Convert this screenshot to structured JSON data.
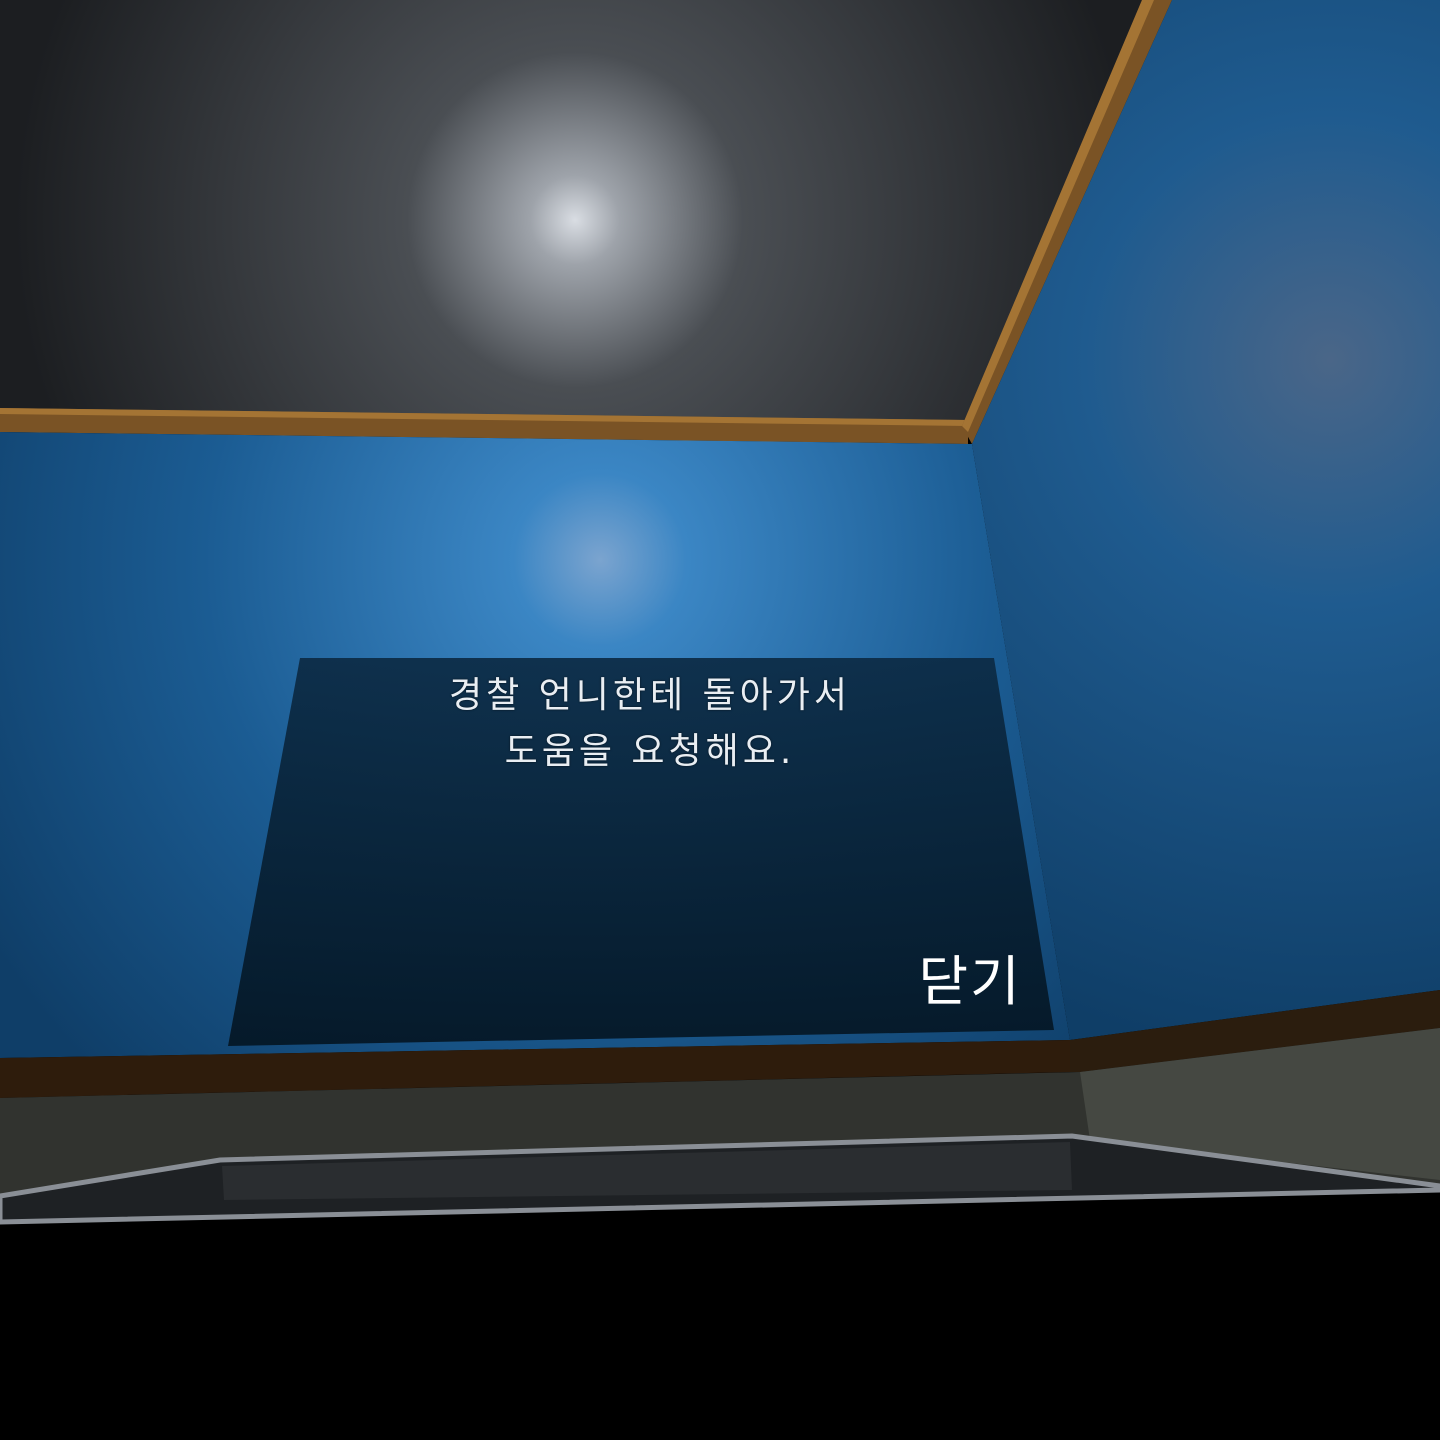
{
  "dialog": {
    "message_line_1": "경찰 언니한테 돌아가서",
    "message_line_2": "도움을 요청해요.",
    "close_label": "닫기"
  },
  "colors": {
    "ceiling": "#2a2d30",
    "wall_blue": "#1f5a8c",
    "trim_brown": "#7a5325",
    "panel_dark": "#0a2236",
    "floor_gray": "#3c3f3a"
  }
}
